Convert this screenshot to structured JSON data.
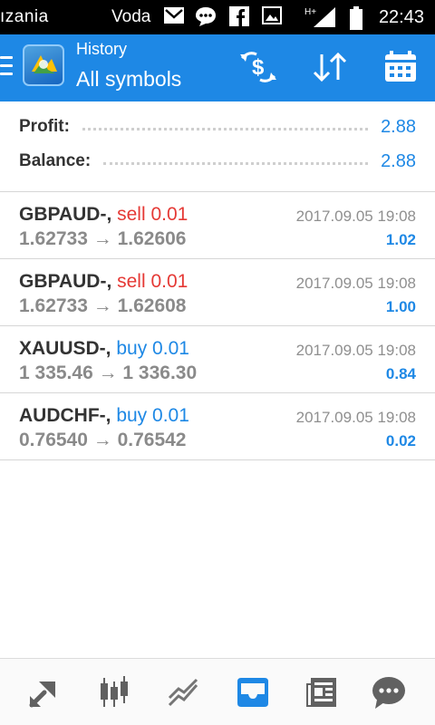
{
  "status_bar": {
    "carrier": "ızania",
    "carrier2": "Voda",
    "time": "22:43",
    "icons": [
      "mail-icon",
      "chat-icon",
      "facebook-icon",
      "image-icon",
      "signal-icon",
      "battery-icon"
    ]
  },
  "header": {
    "title": "History",
    "subtitle": "All symbols",
    "actions": [
      "currency-exchange-icon",
      "sort-icon",
      "calendar-icon"
    ]
  },
  "summary": {
    "profit_label": "Profit:",
    "profit_value": "2.88",
    "balance_label": "Balance:",
    "balance_value": "2.88"
  },
  "trades": [
    {
      "symbol": "GBPAUD-,",
      "action": "sell 0.01",
      "type": "sell",
      "prices": "1.62733 → 1.62606",
      "date": "2017.09.05 19:08",
      "profit": "1.02"
    },
    {
      "symbol": "GBPAUD-,",
      "action": "sell 0.01",
      "type": "sell",
      "prices": "1.62733 → 1.62608",
      "date": "2017.09.05 19:08",
      "profit": "1.00"
    },
    {
      "symbol": "XAUUSD-,",
      "action": "buy 0.01",
      "type": "buy",
      "prices": "1 335.46 → 1 336.30",
      "date": "2017.09.05 19:08",
      "profit": "0.84"
    },
    {
      "symbol": "AUDCHF-,",
      "action": "buy 0.01",
      "type": "buy",
      "prices": "0.76540 → 0.76542",
      "date": "2017.09.05 19:08",
      "profit": "0.02"
    }
  ],
  "bottom_nav": {
    "items": [
      "quotes-icon",
      "chart-icon",
      "trade-icon",
      "history-icon",
      "news-icon",
      "chat-icon"
    ],
    "active": "history-icon"
  },
  "colors": {
    "accent": "#1e88e5",
    "sell": "#e53935",
    "buy": "#1e88e5"
  }
}
